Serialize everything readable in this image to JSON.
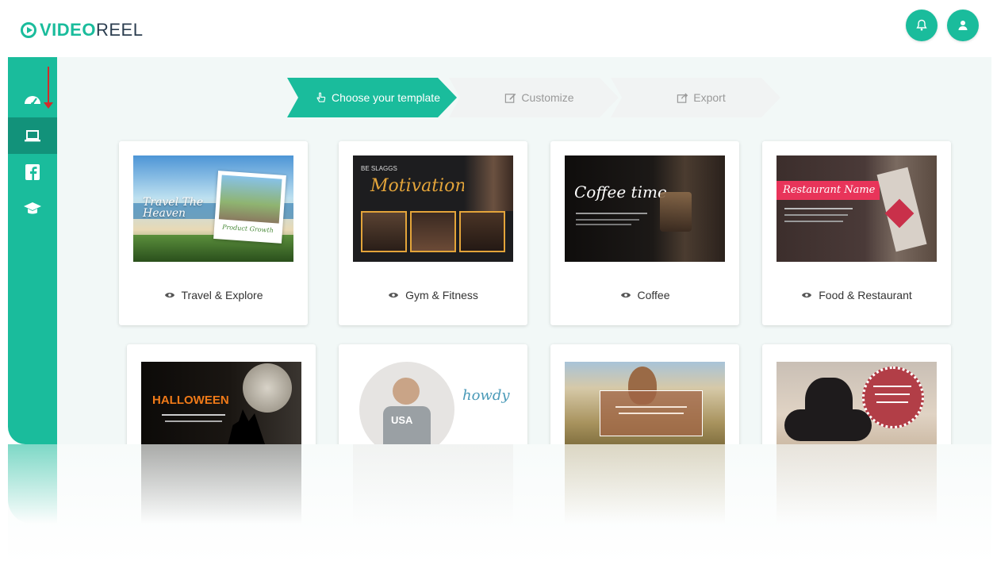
{
  "app": {
    "logo_prefix": "VIDEO",
    "logo_suffix": "REEL"
  },
  "header": {
    "notification_icon": "bell-icon",
    "profile_icon": "user-icon"
  },
  "sidebar": {
    "items": [
      {
        "icon": "dashboard-icon",
        "active": false
      },
      {
        "icon": "laptop-icon",
        "active": true
      },
      {
        "icon": "facebook-icon",
        "active": false
      },
      {
        "icon": "graduation-cap-icon",
        "active": false
      }
    ]
  },
  "wizard": {
    "steps": [
      {
        "label": "Choose your template",
        "icon": "hand-pointer-icon",
        "active": true
      },
      {
        "label": "Customize",
        "icon": "edit-icon",
        "active": false
      },
      {
        "label": "Export",
        "icon": "share-icon",
        "active": false
      }
    ]
  },
  "templates": [
    {
      "label": "Travel & Explore",
      "thumb_title": "Travel The Heaven",
      "thumb_caption": "Product Growth"
    },
    {
      "label": "Gym & Fitness",
      "thumb_title": "Motivation",
      "thumb_kicker": "BE SLAGGS"
    },
    {
      "label": "Coffee",
      "thumb_title": "Coffee time"
    },
    {
      "label": "Food & Restaurant",
      "thumb_title": "Restaurant Name"
    },
    {
      "label": "",
      "thumb_title": "HALLOWEEN"
    },
    {
      "label": "",
      "thumb_title": "howdy",
      "thumb_shirt": "USA"
    },
    {
      "label": "",
      "thumb_title": ""
    },
    {
      "label": "",
      "thumb_title": ""
    }
  ],
  "colors": {
    "accent": "#1abc9c",
    "accent_dark": "#12927a",
    "arrow": "#d12b2b"
  }
}
